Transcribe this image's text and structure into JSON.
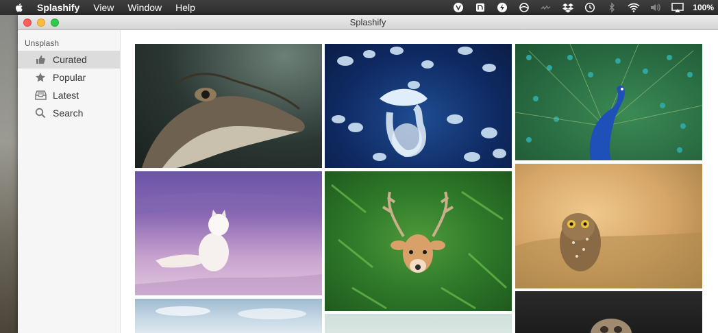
{
  "menubar": {
    "app_name": "Splashify",
    "items": [
      "View",
      "Window",
      "Help"
    ],
    "battery": "100%"
  },
  "window": {
    "title": "Splashify"
  },
  "sidebar": {
    "section": "Unsplash",
    "items": [
      {
        "label": "Curated",
        "icon": "thumbs-up-icon",
        "active": true
      },
      {
        "label": "Popular",
        "icon": "star-icon",
        "active": false
      },
      {
        "label": "Latest",
        "icon": "inbox-icon",
        "active": false
      },
      {
        "label": "Search",
        "icon": "search-icon",
        "active": false
      }
    ]
  },
  "photos": [
    {
      "subject": "crocodile",
      "icon": "crocodile-photo"
    },
    {
      "subject": "jellyfish",
      "icon": "jellyfish-photo"
    },
    {
      "subject": "peacock",
      "icon": "peacock-photo"
    },
    {
      "subject": "arctic-fox",
      "icon": "arctic-fox-photo"
    },
    {
      "subject": "deer",
      "icon": "deer-photo"
    },
    {
      "subject": "owl",
      "icon": "owl-photo"
    },
    {
      "subject": "snowy-landscape",
      "icon": "landscape-photo"
    },
    {
      "subject": "pale-landscape",
      "icon": "landscape-photo"
    },
    {
      "subject": "pug",
      "icon": "pug-photo"
    }
  ],
  "colors": {
    "menubar": "#2e2e2e",
    "sidebar_bg": "#f6f6f6",
    "sidebar_active": "#dcdcdc"
  }
}
